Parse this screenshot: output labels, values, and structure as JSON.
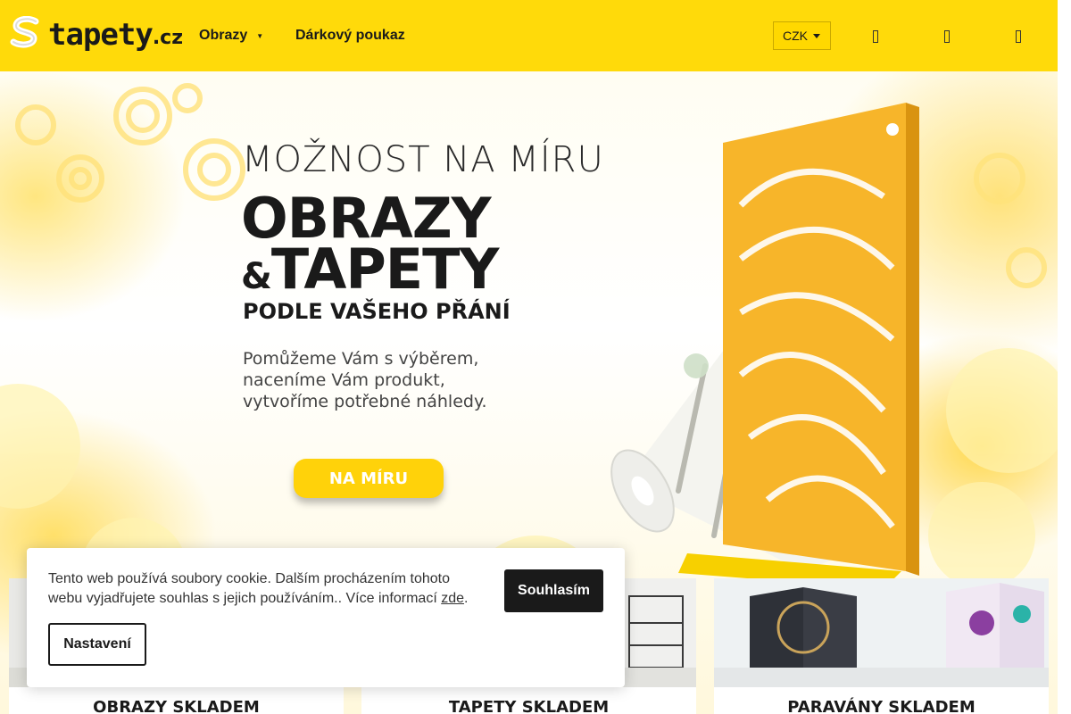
{
  "header": {
    "logo_text": "tapety",
    "logo_tld": ".cz",
    "nav": [
      {
        "label": "Obrazy",
        "caret": "▼"
      },
      {
        "label": "Dárkový poukaz"
      }
    ],
    "currency": "CZK",
    "icons": [
      "search-icon",
      "user-icon",
      "cart-icon"
    ],
    "accent_color": "#ffda0a"
  },
  "hero": {
    "line1": "MOŽNOST NA MÍRU",
    "line2": "OBRAZY",
    "line3_amp": "&",
    "line3_word": "TAPETY",
    "line4": "PODLE VAŠEHO PŘÁNÍ",
    "paragraph": [
      "Pomůžeme Vám s výběrem,",
      "naceníme Vám produkt,",
      "vytvoříme potřebné náhledy."
    ],
    "button": "NA MÍRU"
  },
  "tiles": [
    {
      "label": "OBRAZY SKLADEM"
    },
    {
      "label": "TAPETY SKLADEM"
    },
    {
      "label": "PARAVÁNY SKLADEM"
    }
  ],
  "cookie": {
    "text": "Tento web používá soubory cookie. Dalším procházením tohoto webu vyjadřujete souhlas s jejich používáním.. Více informací ",
    "link": "zde",
    "after_link": ".",
    "accept": "Souhlasím",
    "settings": "Nastavení"
  }
}
